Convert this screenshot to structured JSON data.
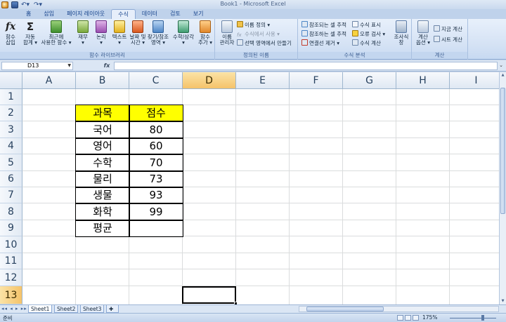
{
  "window": {
    "title": "Book1 - Microsoft Excel"
  },
  "tabs": [
    "홈",
    "삽입",
    "페이지 레이아웃",
    "수식",
    "데이터",
    "검토",
    "보기"
  ],
  "ribbon": {
    "group_library": {
      "label": "함수 라이브러리",
      "insert_function": [
        "함수",
        "삽입"
      ],
      "autosum": [
        "자동",
        "합계 ▾"
      ],
      "recent": [
        "최근에",
        "사용한 함수 ▾"
      ],
      "financial": [
        "재무",
        "▾"
      ],
      "logical": [
        "논리",
        "▾"
      ],
      "text": [
        "텍스트",
        "▾"
      ],
      "datetime": [
        "날짜 및",
        "시간 ▾"
      ],
      "lookup": [
        "찾기/참조",
        "영역 ▾"
      ],
      "math": [
        "수학/삼각",
        "▾"
      ],
      "more": [
        "함수",
        "추가 ▾"
      ]
    },
    "group_names": {
      "label": "정의된 이름",
      "manager": [
        "이름",
        "관리자"
      ],
      "define": "이름 정의 ▾",
      "use_in_formula": "수식에서 사용 ▾",
      "create_from_selection": "선택 영역에서 만들기"
    },
    "group_audit": {
      "label": "수식 분석",
      "trace_precedents": "참조되는 셀 추적",
      "trace_dependents": "참조하는 셀 추적",
      "remove_arrows": "연결선 제거 ▾",
      "show_formulas": "수식 표시",
      "error_check": "오류 검사 ▾",
      "evaluate": "수식 계산",
      "watch": [
        "조사식",
        "창"
      ]
    },
    "group_calc": {
      "label": "계산",
      "options": [
        "계산",
        "옵션 ▾"
      ],
      "calc_now": "지금 계산",
      "calc_sheet": "시트 계산"
    }
  },
  "formula_bar": {
    "name_box": "D13",
    "fx_label": "fx",
    "formula": ""
  },
  "columns": [
    "A",
    "B",
    "C",
    "D",
    "E",
    "F",
    "G",
    "H",
    "I"
  ],
  "rows": [
    "1",
    "2",
    "3",
    "4",
    "5",
    "6",
    "7",
    "8",
    "9",
    "10",
    "11",
    "12",
    "13"
  ],
  "selected": {
    "column": "D",
    "row": "13"
  },
  "table": {
    "headers": [
      "과목",
      "점수"
    ],
    "rows": [
      [
        "국어",
        "80"
      ],
      [
        "영어",
        "60"
      ],
      [
        "수학",
        "70"
      ],
      [
        "물리",
        "73"
      ],
      [
        "생물",
        "93"
      ],
      [
        "화학",
        "99"
      ],
      [
        "평균",
        ""
      ]
    ]
  },
  "sheets": [
    "Sheet1",
    "Sheet2",
    "Sheet3"
  ],
  "active_sheet": "Sheet1",
  "status": {
    "mode": "준비",
    "zoom": "175%"
  },
  "colors": {
    "header_fill": "#ffff00",
    "selected_header": "#f5c36a",
    "ribbon": "#d3e1f4"
  }
}
